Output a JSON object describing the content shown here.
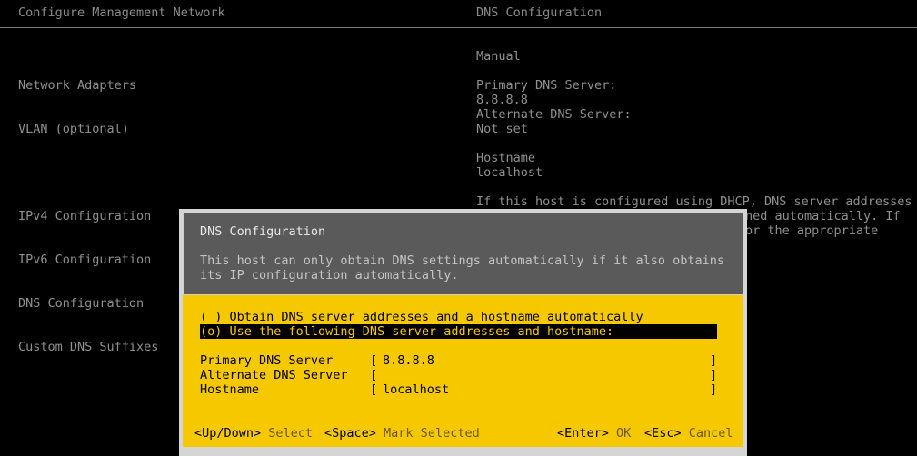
{
  "header": {
    "left_title": "Configure Management Network",
    "right_title": "DNS Configuration"
  },
  "menu": {
    "items": [
      "Network Adapters",
      "VLAN (optional)",
      "IPv4 Configuration",
      "IPv6 Configuration",
      "DNS Configuration",
      "Custom DNS Suffixes"
    ]
  },
  "info": {
    "mode": "Manual",
    "primary_label": "Primary DNS Server:",
    "primary_value": "8.8.8.8",
    "alternate_label": "Alternate DNS Server:",
    "alternate_value": "Not set",
    "hostname_label": "Hostname",
    "hostname_value": "localhost",
    "note_line1": "If this host is configured using DHCP, DNS server addresses",
    "note_line2": "ned automatically. If",
    "note_line3": "or the appropriate"
  },
  "dialog": {
    "title": "DNS Configuration",
    "message_line1": "This host can only obtain DNS settings automatically if it also obtains",
    "message_line2": "its IP configuration automatically.",
    "option_auto": "( ) Obtain DNS server addresses and a hostname automatically",
    "option_manual": "(o) Use the following DNS server addresses and hostname:",
    "fields": {
      "primary_label": "Primary DNS Server",
      "primary_value": "8.8.8.8",
      "alternate_label": "Alternate DNS Server",
      "alternate_value": "",
      "hostname_label": "Hostname",
      "hostname_value": "localhost",
      "open_bracket": "[",
      "close_bracket": "]"
    },
    "footer": {
      "updown_key": "<Up/Down>",
      "updown_action": "Select",
      "space_key": "<Space>",
      "space_action": "Mark Selected",
      "enter_key": "<Enter>",
      "enter_action": "OK",
      "esc_key": "<Esc>",
      "esc_action": "Cancel"
    }
  }
}
